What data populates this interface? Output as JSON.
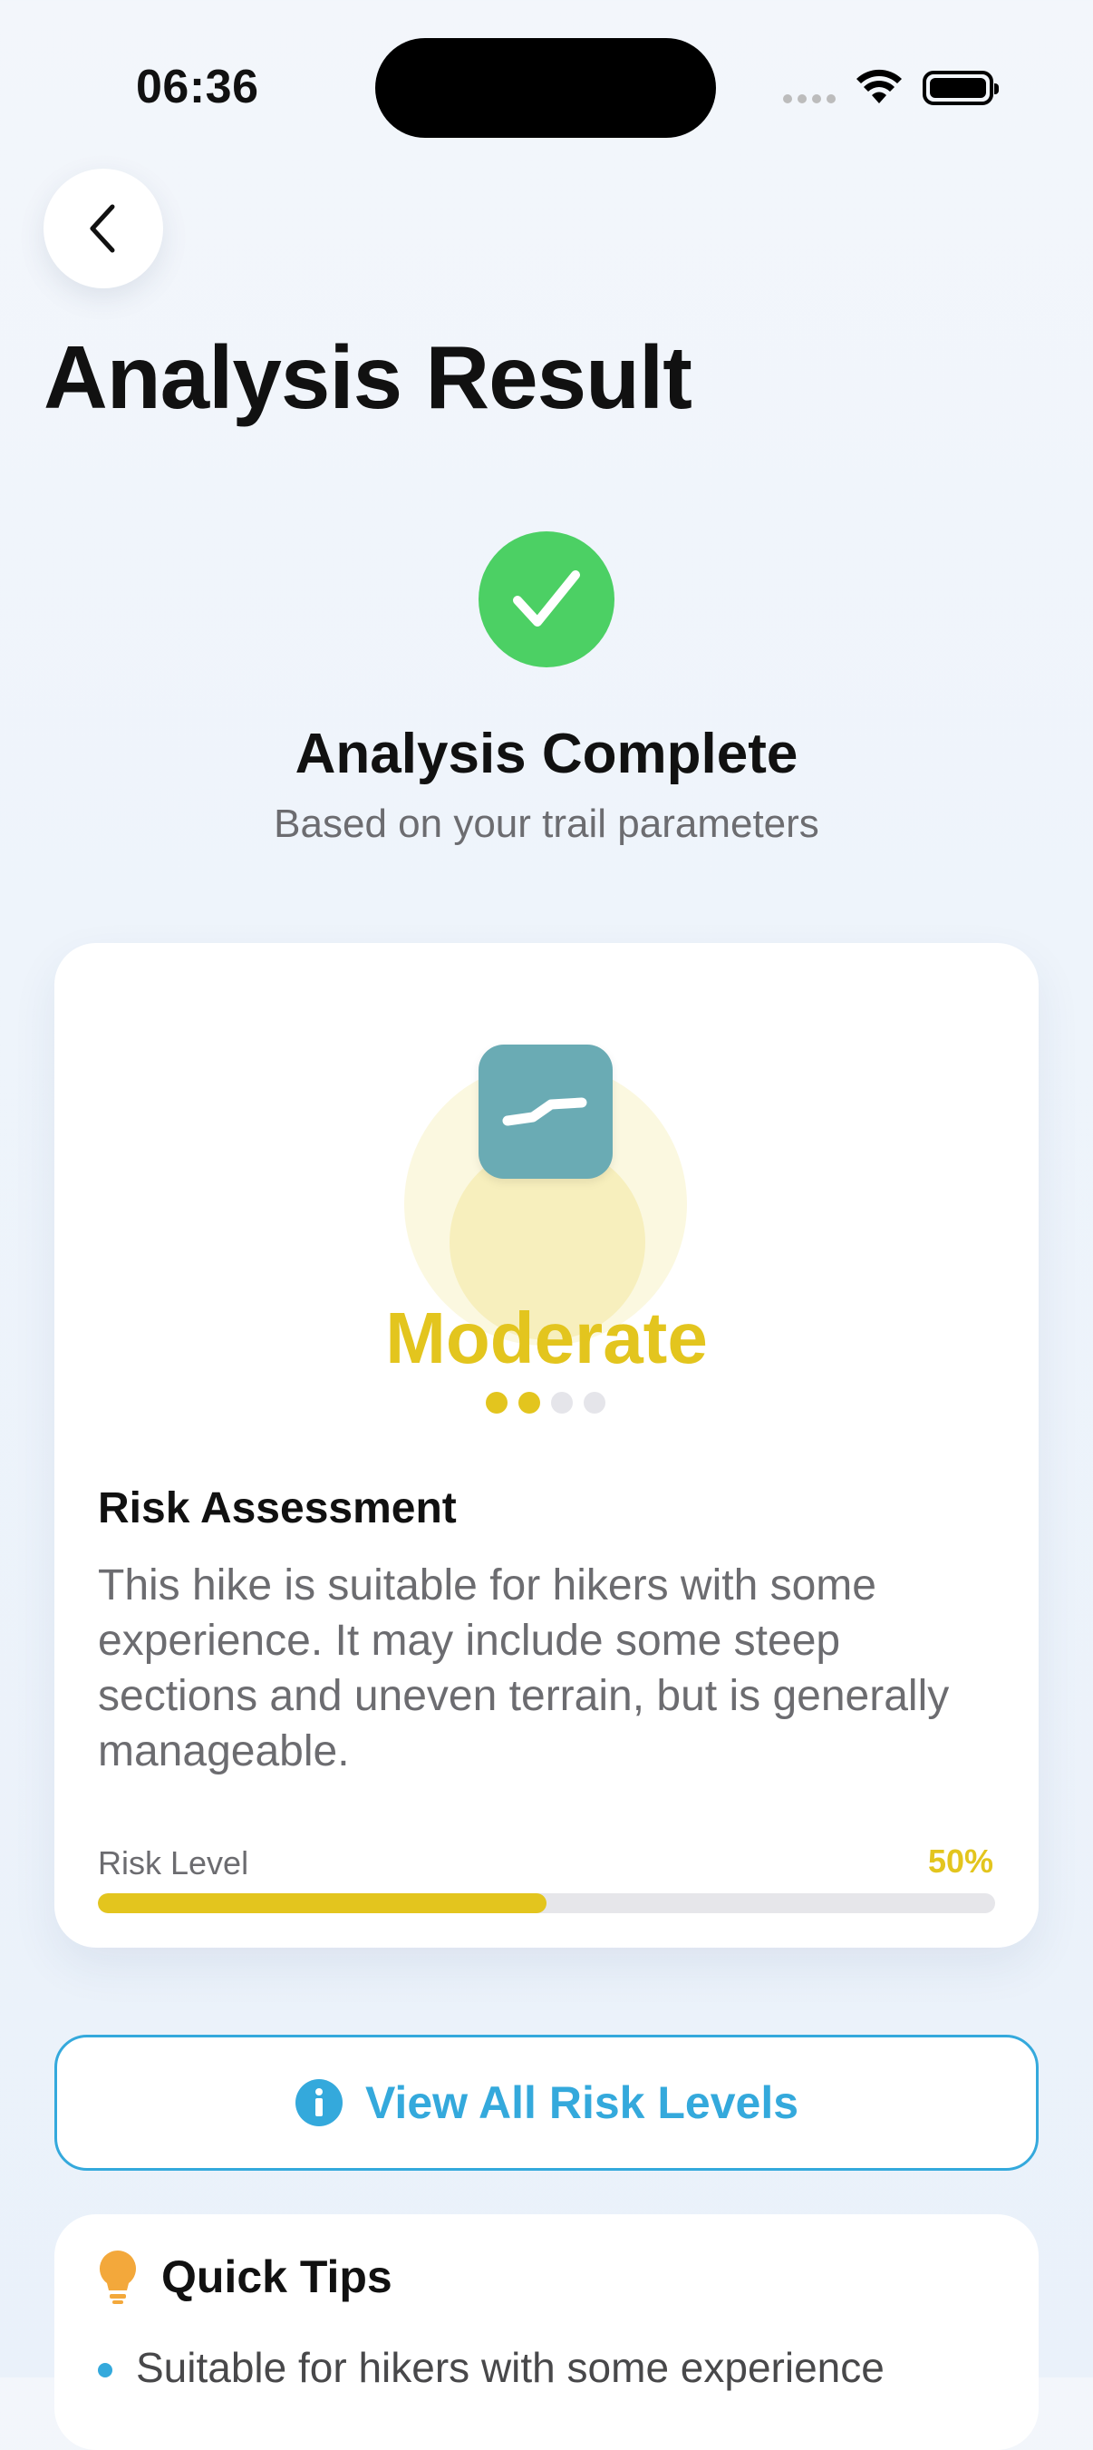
{
  "status_bar": {
    "time": "06:36"
  },
  "header": {
    "title": "Analysis Result",
    "back_icon": "chevron-left-icon"
  },
  "result": {
    "title": "Analysis Complete",
    "subtitle": "Based on your trail parameters",
    "icon": "checkmark-icon",
    "color": "#4cd064"
  },
  "risk_card": {
    "level_name": "Moderate",
    "level_color": "#e3c51e",
    "icon": "trail-path-icon",
    "dots_total": 4,
    "dots_active": 2,
    "assessment_title": "Risk Assessment",
    "assessment_text": "This hike is suitable for hikers with some experience. It may include some steep sections and uneven terrain, but is generally manageable.",
    "risk_level_label": "Risk Level",
    "risk_level_value": "50%",
    "risk_level_fraction": 0.5
  },
  "view_all_button": {
    "label": "View All Risk Levels",
    "icon": "info-circle-icon",
    "color": "#34a9dc"
  },
  "tips": {
    "title": "Quick Tips",
    "icon": "lightbulb-icon",
    "items": [
      "Suitable for hikers with some experience"
    ]
  }
}
